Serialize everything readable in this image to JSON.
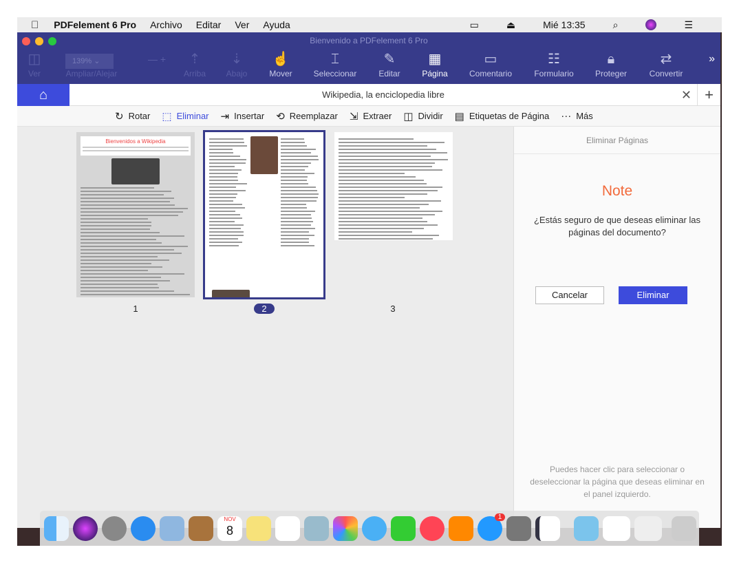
{
  "menubar": {
    "app": "PDFelement 6 Pro",
    "items": [
      "Archivo",
      "Editar",
      "Ver",
      "Ayuda"
    ],
    "clock": "Mié 13:35"
  },
  "window": {
    "title": "Bienvenido a PDFelement 6 Pro"
  },
  "toolbar": {
    "zoom": "139%",
    "items": [
      {
        "label": "Ver",
        "icon": "panel-icon",
        "state": "dis"
      },
      {
        "label": "Ampliar/Alejar",
        "icon": "zoom-icon",
        "state": "dis"
      },
      {
        "label": "Arriba",
        "icon": "page-up-icon",
        "state": "dis"
      },
      {
        "label": "Abajo",
        "icon": "page-down-icon",
        "state": "dis"
      },
      {
        "label": "Mover",
        "icon": "hand-icon",
        "state": ""
      },
      {
        "label": "Seleccionar",
        "icon": "cursor-icon",
        "state": ""
      },
      {
        "label": "Editar",
        "icon": "edit-icon",
        "state": ""
      },
      {
        "label": "Página",
        "icon": "page-icon",
        "state": "active"
      },
      {
        "label": "Comentario",
        "icon": "comment-icon",
        "state": ""
      },
      {
        "label": "Formulario",
        "icon": "form-icon",
        "state": ""
      },
      {
        "label": "Proteger",
        "icon": "lock-icon",
        "state": ""
      },
      {
        "label": "Convertir",
        "icon": "convert-icon",
        "state": ""
      }
    ]
  },
  "tab": {
    "title": "Wikipedia, la enciclopedia libre"
  },
  "pagebar": [
    "Rotar",
    "Eliminar",
    "Insertar",
    "Reemplazar",
    "Extraer",
    "Dividir",
    "Etiquetas de Página",
    "Más"
  ],
  "thumbs": {
    "page1_title": "Bienvenidos a Wikipedia",
    "pages": [
      "1",
      "2",
      "3"
    ]
  },
  "panel": {
    "header": "Eliminar Páginas",
    "note": "Note",
    "question": "¿Estás seguro de que deseas eliminar las páginas del documento?",
    "cancel": "Cancelar",
    "delete": "Eliminar",
    "hint": "Puedes hacer clic para seleccionar o deseleccionar la página que deseas eliminar en el panel izquierdo."
  },
  "dock": {
    "badge": "1",
    "calendar_month": "NOV",
    "calendar_day": "8"
  }
}
